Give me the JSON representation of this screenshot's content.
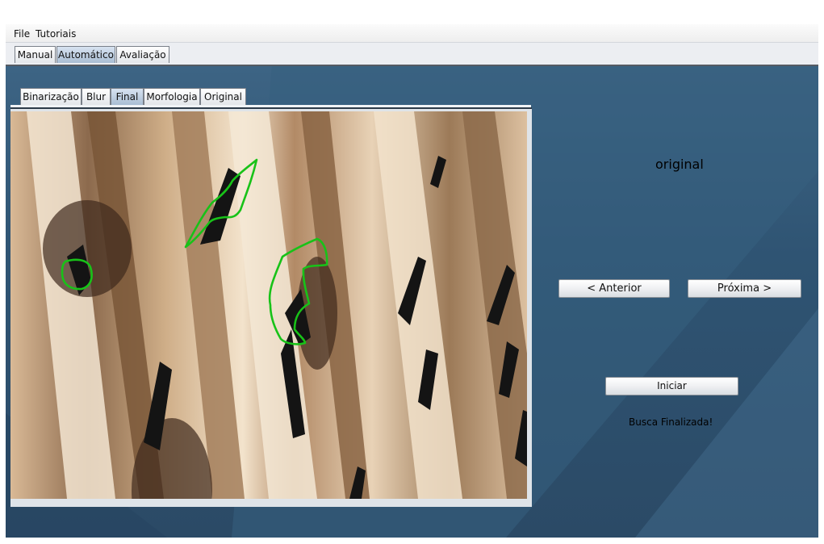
{
  "menu": {
    "file": "File",
    "tutorials": "Tutoriais"
  },
  "main_tabs": [
    {
      "label": "Manual",
      "active": false
    },
    {
      "label": "Automático",
      "active": true
    },
    {
      "label": "Avaliação",
      "active": false
    }
  ],
  "image_tabs": [
    {
      "label": "Binarização",
      "active": false
    },
    {
      "label": "Blur",
      "active": false
    },
    {
      "label": "Final",
      "active": true
    },
    {
      "label": "Morfologia",
      "active": false
    },
    {
      "label": "Original",
      "active": false
    }
  ],
  "panel": {
    "image_name": "original",
    "prev_label": "< Anterior",
    "next_label": "Próxima >",
    "start_label": "Iniciar",
    "status": "Busca Finalizada!"
  },
  "colors": {
    "detection_outline": "#18c218",
    "background": "#2f5473"
  }
}
